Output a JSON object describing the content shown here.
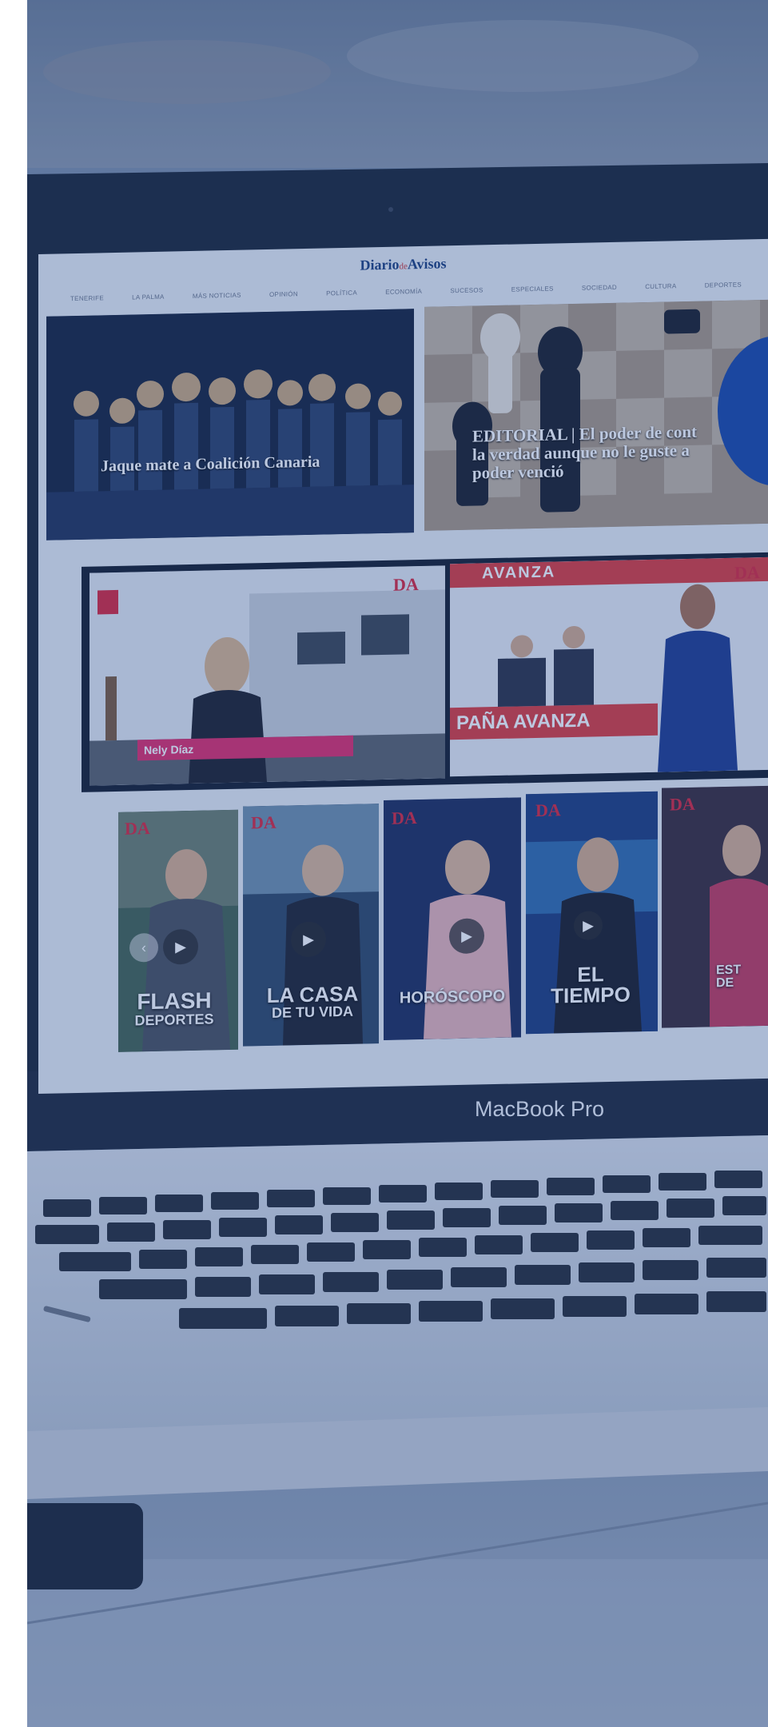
{
  "screen": {
    "logo": "Diario",
    "logo_mid": "de",
    "logo_end": "Avisos",
    "nav": [
      "TENERIFE",
      "LA PALMA",
      "MÁS NOTICIAS",
      "OPINIÓN",
      "POLÍTICA",
      "ECONOMÍA",
      "SUCESOS",
      "ESPECIALES",
      "SOCIEDAD",
      "CULTURA",
      "DEPORTES"
    ],
    "hero_left_headline": "Jaque mate a Coalición Canaria",
    "hero_right_headline": [
      "EDITORIAL | El poder de cont",
      "la verdad aunque no le guste a",
      "poder venció"
    ],
    "video_left_name": "Nely Díaz",
    "video_right_banner": "PAÑA AVANZA",
    "video_right_top": "AVANZA",
    "badge": "DA",
    "programs": [
      {
        "title_1": "FLASH",
        "title_2": "DEPORTES"
      },
      {
        "title_1": "LA CASA",
        "title_2": "DE TU VIDA"
      },
      {
        "title_1": "HORÓSCOPO",
        "title_2": ""
      },
      {
        "title_1": "EL",
        "title_2": "TIEMPO"
      },
      {
        "title_1": "EST",
        "title_2": "DE"
      }
    ]
  },
  "device_label": "MacBook Pro",
  "colors": {
    "overlay": "#224a96",
    "accent_circle": "#1b47a0",
    "badge_red": "#d8263a",
    "logo_blue": "#1d3f7c"
  }
}
